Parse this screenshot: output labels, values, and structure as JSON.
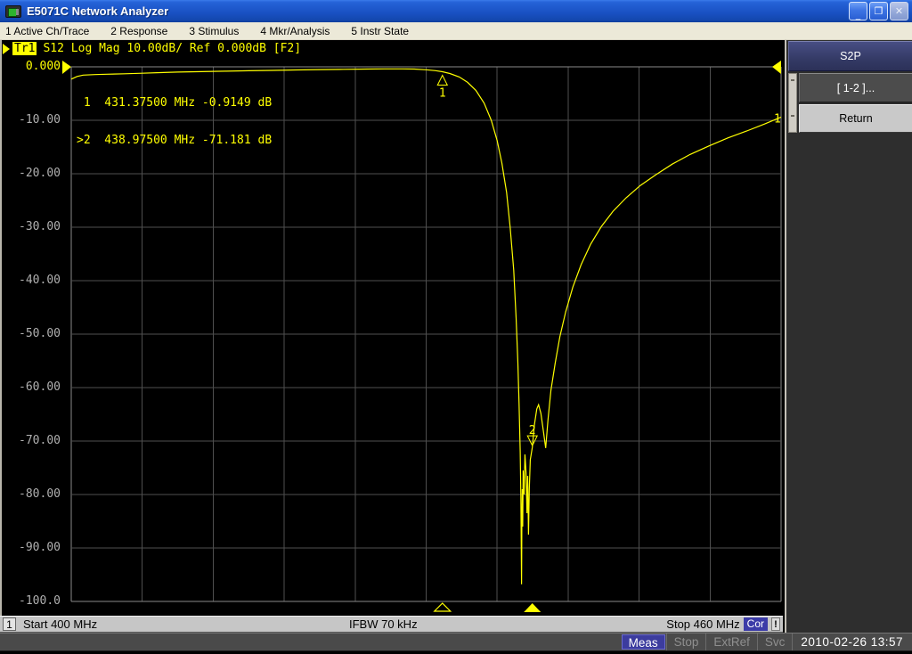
{
  "window": {
    "title": "E5071C Network Analyzer",
    "minimize_glyph": "_",
    "restore_glyph": "❐",
    "close_glyph": "✕"
  },
  "menu_bar": {
    "items": [
      {
        "label": "1 Active Ch/Trace"
      },
      {
        "label": "2 Response"
      },
      {
        "label": "3 Stimulus"
      },
      {
        "label": "4 Mkr/Analysis"
      },
      {
        "label": "5 Instr State"
      }
    ]
  },
  "trace_header": {
    "trace_badge": "Tr1",
    "text": "S12 Log Mag 10.00dB/ Ref 0.000dB [F2]"
  },
  "marker_readout": {
    "rows": [
      " 1  431.37500 MHz -0.9149 dB",
      ">2  438.97500 MHz -71.181 dB"
    ]
  },
  "softkeys": {
    "title": "S2P",
    "buttons": [
      {
        "label": "[ 1-2 ]..."
      },
      {
        "label": "Return"
      }
    ]
  },
  "status_bar": {
    "channel": "1",
    "start": "Start 400 MHz",
    "ifbw": "IFBW 70 kHz",
    "stop": "Stop 460 MHz",
    "correction": "Cor",
    "alert": "!"
  },
  "instrument_bar": {
    "meas": "Meas",
    "stop": "Stop",
    "extref": "ExtRef",
    "svc": "Svc",
    "datetime": "2010-02-26 13:57"
  },
  "colors": {
    "trace": "#ffff00",
    "grid_inner": "#4f4f4f",
    "grid_border": "#8a8a8a",
    "y_label": "#b0b0b0",
    "softkey_title_bg": "#343a66",
    "status_cor_bg": "#3b3ba8",
    "meas_bg": "#3c3c9e"
  },
  "chart_data": {
    "type": "line",
    "trace_name": "Tr1 S12 Log Mag",
    "x_unit": "MHz",
    "y_unit": "dB",
    "x_range": [
      400,
      460
    ],
    "y_range": [
      -100,
      0
    ],
    "scale_per_div": 10,
    "reference_level": 0,
    "grid_divisions_x": 10,
    "grid_divisions_y": 10,
    "y_tick_labels": [
      "0.000",
      "-10.00",
      "-20.00",
      "-30.00",
      "-40.00",
      "-50.00",
      "-60.00",
      "-70.00",
      "-80.00",
      "-90.00",
      "-100.0"
    ],
    "trace_end_label": "1",
    "markers": [
      {
        "n": "1",
        "freq_mhz": 431.375,
        "db": -0.9149,
        "label_pos": "below",
        "active": false
      },
      {
        "n": "2",
        "freq_mhz": 438.975,
        "db": -71.181,
        "label_pos": "above",
        "active": true
      }
    ],
    "points": [
      [
        400,
        -2.3
      ],
      [
        400.5,
        -1.8
      ],
      [
        401,
        -1.55
      ],
      [
        402,
        -1.45
      ],
      [
        403,
        -1.38
      ],
      [
        404.5,
        -1.3
      ],
      [
        406,
        -1.2
      ],
      [
        407.5,
        -1.08
      ],
      [
        409,
        -0.98
      ],
      [
        411,
        -0.9
      ],
      [
        413,
        -0.82
      ],
      [
        415,
        -0.74
      ],
      [
        417,
        -0.66
      ],
      [
        419,
        -0.58
      ],
      [
        421,
        -0.52
      ],
      [
        423,
        -0.46
      ],
      [
        425,
        -0.41
      ],
      [
        426.5,
        -0.38
      ],
      [
        428,
        -0.38
      ],
      [
        429,
        -0.42
      ],
      [
        430,
        -0.55
      ],
      [
        430.8,
        -0.72
      ],
      [
        431.375,
        -0.9149
      ],
      [
        432,
        -1.25
      ],
      [
        432.8,
        -1.9
      ],
      [
        433.5,
        -2.9
      ],
      [
        434.2,
        -4.4
      ],
      [
        434.9,
        -6.8
      ],
      [
        435.5,
        -10
      ],
      [
        436,
        -13.8
      ],
      [
        436.4,
        -18
      ],
      [
        436.8,
        -23.5
      ],
      [
        437.1,
        -30
      ],
      [
        437.4,
        -38
      ],
      [
        437.6,
        -47
      ],
      [
        437.75,
        -55
      ],
      [
        437.85,
        -63
      ],
      [
        437.95,
        -72
      ],
      [
        438.0,
        -80
      ],
      [
        438.03,
        -88
      ],
      [
        438.06,
        -96.8
      ],
      [
        438.09,
        -84
      ],
      [
        438.12,
        -79
      ],
      [
        438.16,
        -86
      ],
      [
        438.2,
        -75.5
      ],
      [
        438.28,
        -80
      ],
      [
        438.35,
        -72.5
      ],
      [
        438.45,
        -76
      ],
      [
        438.52,
        -83.5
      ],
      [
        438.58,
        -76.5
      ],
      [
        438.65,
        -87.5
      ],
      [
        438.72,
        -79
      ],
      [
        438.8,
        -73.5
      ],
      [
        438.975,
        -71.181
      ],
      [
        439.15,
        -67
      ],
      [
        439.35,
        -64
      ],
      [
        439.5,
        -63.2
      ],
      [
        439.7,
        -64.8
      ],
      [
        439.9,
        -68
      ],
      [
        440.1,
        -71.3
      ],
      [
        440.3,
        -66
      ],
      [
        440.55,
        -60.5
      ],
      [
        440.9,
        -55.5
      ],
      [
        441.3,
        -50.5
      ],
      [
        441.8,
        -45.8
      ],
      [
        442.4,
        -41.2
      ],
      [
        443.1,
        -37
      ],
      [
        443.9,
        -33.2
      ],
      [
        444.8,
        -29.9
      ],
      [
        445.8,
        -27
      ],
      [
        446.9,
        -24.5
      ],
      [
        448.1,
        -22.2
      ],
      [
        449.4,
        -20.2
      ],
      [
        450.8,
        -18.2
      ],
      [
        452.3,
        -16.4
      ],
      [
        453.9,
        -14.8
      ],
      [
        455.5,
        -13.3
      ],
      [
        457.1,
        -12
      ],
      [
        458.6,
        -10.7
      ],
      [
        460,
        -9.4
      ]
    ]
  }
}
